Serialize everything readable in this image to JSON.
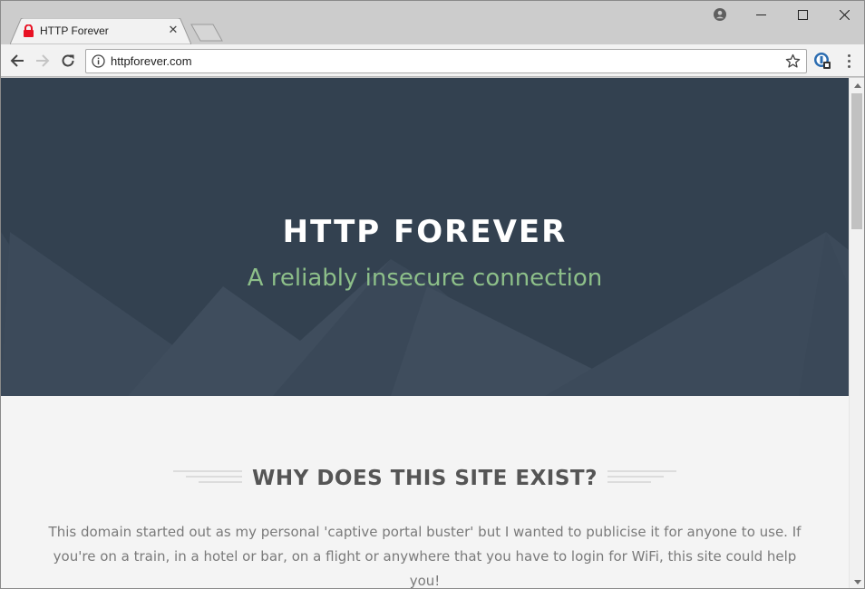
{
  "browser": {
    "tab_title": "HTTP Forever",
    "tab_close_glyph": "✕",
    "url": "httpforever.com"
  },
  "icons": {
    "tab": "lock-icon",
    "profile": "profile-icon",
    "minimize": "minimize-icon",
    "maximize": "maximize-icon",
    "close": "close-icon",
    "back": "back-arrow-icon",
    "forward": "forward-arrow-icon",
    "reload": "reload-icon",
    "info": "info-icon",
    "bookmark": "star-icon",
    "extension": "extension-icon",
    "menu": "kebab-menu-icon"
  },
  "hero": {
    "title": "HTTP FOREVER",
    "subtitle": "A reliably insecure connection"
  },
  "section": {
    "title": "WHY DOES THIS SITE EXIST?",
    "body": "This domain started out as my personal 'captive portal buster' but I wanted to publicise it for anyone to use. If you're on a train, in a hotel or bar, on a flight or anywhere that you have to login for WiFi, this site could help you!"
  },
  "colors": {
    "hero_bg": "#334150",
    "subtitle": "#8dbf89",
    "page_bg": "#f4f4f4",
    "lock": "#e81123"
  }
}
